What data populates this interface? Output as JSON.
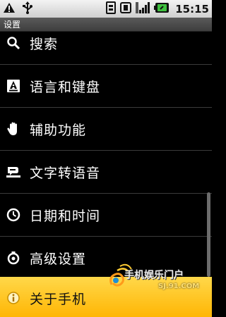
{
  "status_bar": {
    "time": "15:15",
    "icons": [
      "warning-icon",
      "usb-icon",
      "sim-icon",
      "vibrate-icon",
      "signal-icon",
      "battery-icon"
    ]
  },
  "title_bar": {
    "title": "设置"
  },
  "menu": {
    "items": [
      {
        "label": "搜索",
        "icon": "search-icon"
      },
      {
        "label": "语言和键盘",
        "icon": "language-keyboard-icon"
      },
      {
        "label": "辅助功能",
        "icon": "hand-icon"
      },
      {
        "label": "文字转语音",
        "icon": "text-to-speech-icon"
      },
      {
        "label": "日期和时间",
        "icon": "clock-icon"
      },
      {
        "label": "高级设置",
        "icon": "gear-icon"
      },
      {
        "label": "关于手机",
        "icon": "info-icon",
        "selected": true
      }
    ]
  },
  "watermark": {
    "brand": "手机娱乐门户",
    "url": "SJ.91.COM"
  },
  "colors": {
    "status_bar": "#dcdcdc",
    "title_bar": "#4a4a4a",
    "selected_item": "#ffc21a",
    "background": "#000000"
  }
}
